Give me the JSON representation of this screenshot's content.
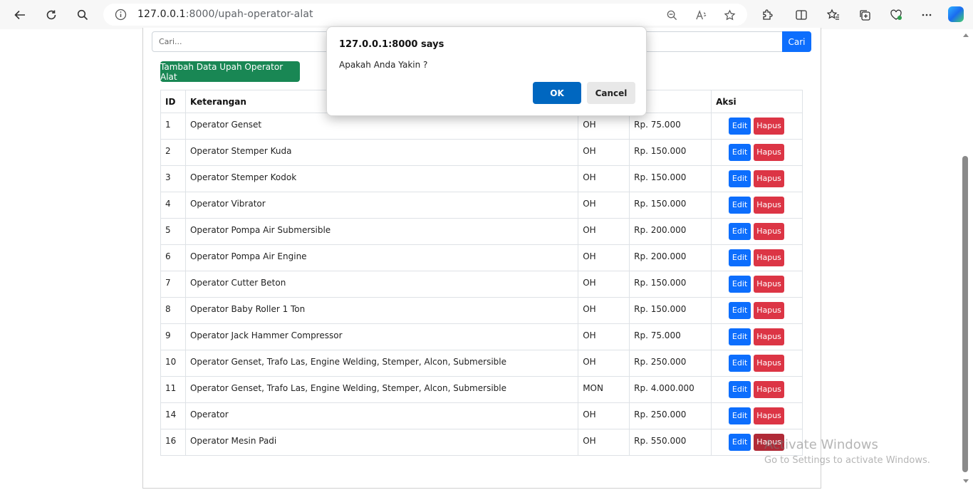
{
  "browser": {
    "url_host": "127.0.0.1",
    "url_rest": ":8000/upah-operator-alat"
  },
  "page": {
    "search_placeholder": "Cari...",
    "search_button": "Cari",
    "add_button": "Tambah Data Upah Operator Alat",
    "table": {
      "headers": [
        "ID",
        "Keterangan",
        "",
        "ah",
        "Aksi"
      ],
      "edit_label": "Edit",
      "delete_label": "Hapus",
      "rows": [
        {
          "id": "1",
          "ket": "Operator Genset",
          "sat": "OH",
          "upah": "Rp. 75.000"
        },
        {
          "id": "2",
          "ket": "Operator Stemper Kuda",
          "sat": "OH",
          "upah": "Rp. 150.000"
        },
        {
          "id": "3",
          "ket": "Operator Stemper Kodok",
          "sat": "OH",
          "upah": "Rp. 150.000"
        },
        {
          "id": "4",
          "ket": "Operator Vibrator",
          "sat": "OH",
          "upah": "Rp. 150.000"
        },
        {
          "id": "5",
          "ket": "Operator Pompa Air Submersible",
          "sat": "OH",
          "upah": "Rp. 200.000"
        },
        {
          "id": "6",
          "ket": "Operator Pompa Air Engine",
          "sat": "OH",
          "upah": "Rp. 200.000"
        },
        {
          "id": "7",
          "ket": "Operator Cutter Beton",
          "sat": "OH",
          "upah": "Rp. 150.000"
        },
        {
          "id": "8",
          "ket": "Operator Baby Roller 1 Ton",
          "sat": "OH",
          "upah": "Rp. 150.000"
        },
        {
          "id": "9",
          "ket": "Operator Jack Hammer Compressor",
          "sat": "OH",
          "upah": "Rp. 75.000"
        },
        {
          "id": "10",
          "ket": "Operator Genset, Trafo Las, Engine Welding, Stemper, Alcon, Submersible",
          "sat": "OH",
          "upah": "Rp. 250.000"
        },
        {
          "id": "11",
          "ket": "Operator Genset, Trafo Las, Engine Welding, Stemper, Alcon, Submersible",
          "sat": "MON",
          "upah": "Rp. 4.000.000"
        },
        {
          "id": "14",
          "ket": "Operator",
          "sat": "OH",
          "upah": "Rp. 250.000"
        },
        {
          "id": "16",
          "ket": "Operator Mesin Padi",
          "sat": "OH",
          "upah": "Rp. 550.000"
        }
      ]
    }
  },
  "dialog": {
    "title": "127.0.0.1:8000 says",
    "message": "Apakah Anda Yakin ?",
    "ok": "OK",
    "cancel": "Cancel"
  },
  "watermark": {
    "line1": "Activate Windows",
    "line2": "Go to Settings to activate Windows."
  },
  "colors": {
    "primary": "#0d6efd",
    "success": "#198754",
    "danger": "#dc3545",
    "dialog_ok": "#0067c0"
  }
}
